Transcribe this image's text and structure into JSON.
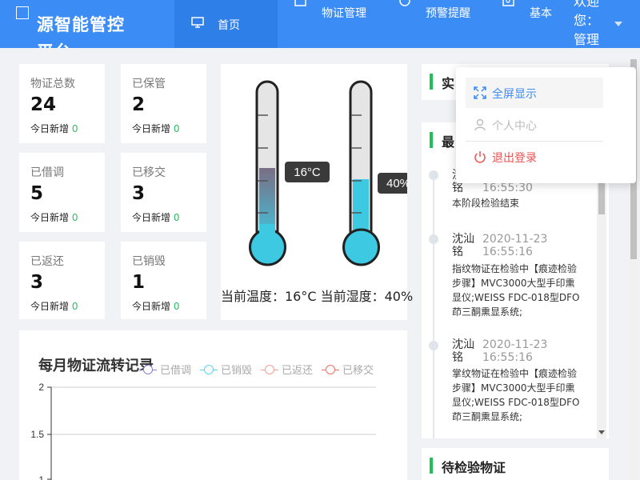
{
  "brand": {
    "name": "源智能管控平台"
  },
  "nav": [
    {
      "label": "首页",
      "active": true
    },
    {
      "label": "物证管理"
    },
    {
      "label": "预警提醒"
    },
    {
      "label": "基本资料"
    }
  ],
  "user": {
    "greeting": "欢迎您：管理员"
  },
  "stats": [
    {
      "label": "物证总数",
      "value": "24",
      "today_label": "今日新增",
      "today": "0"
    },
    {
      "label": "已保管",
      "value": "2",
      "today_label": "今日新增",
      "today": "0"
    },
    {
      "label": "已借调",
      "value": "5",
      "today_label": "今日新增",
      "today": "0"
    },
    {
      "label": "已移交",
      "value": "3",
      "today_label": "今日新增",
      "today": "0"
    },
    {
      "label": "已返还",
      "value": "3",
      "today_label": "今日新增",
      "today": "0"
    },
    {
      "label": "已销毁",
      "value": "1",
      "today_label": "今日新增",
      "today": "0"
    }
  ],
  "gauges": {
    "temperature": {
      "value": 16,
      "unit": "°C",
      "tooltip": "16°C",
      "fill_fraction": 0.47
    },
    "humidity": {
      "value": 40,
      "unit": "%",
      "tooltip": "40%",
      "fill_fraction": 0.4
    },
    "caption": "当前温度：16°C 当前湿度：40%"
  },
  "chart_data": {
    "type": "line",
    "title": "每月物证流转记录",
    "series": [
      {
        "name": "已借调",
        "color": "#8c7fd6"
      },
      {
        "name": "已销毁",
        "color": "#5dd3e8"
      },
      {
        "name": "已返还",
        "color": "#f0a090"
      },
      {
        "name": "已移交",
        "color": "#f07060"
      }
    ],
    "y_ticks": [
      "2",
      "1.5",
      "1"
    ],
    "grid": true,
    "legend_position": "top"
  },
  "realtime": {
    "title": "实"
  },
  "recent": {
    "title": "最",
    "items": [
      {
        "name": "沈汕铭",
        "time": "16:55:30",
        "desc": "本阶段检验结束"
      },
      {
        "name": "沈汕铭",
        "time": "2020-11-23 16:55:16",
        "desc": "指纹物证在检验中【痕迹检验步骤】MVC3000大型手印熏显仪;WEISS FDC-018型DFO茚三酮熏显系统;"
      },
      {
        "name": "沈汕铭",
        "time": "2020-11-23 16:55:16",
        "desc": "掌纹物证在检验中【痕迹检验步骤】MVC3000大型手印熏显仪;WEISS FDC-018型DFO茚三酮熏显系统;"
      }
    ]
  },
  "pending": {
    "title": "待检验物证"
  },
  "dropdown": {
    "items": [
      {
        "label": "全屏显示",
        "icon": "fullscreen-icon",
        "color": "#3c8cf5"
      },
      {
        "label": "个人中心",
        "icon": "user-icon",
        "color": "#bbbbbb"
      },
      {
        "label": "退出登录",
        "icon": "power-icon",
        "color": "#f05050"
      }
    ]
  }
}
